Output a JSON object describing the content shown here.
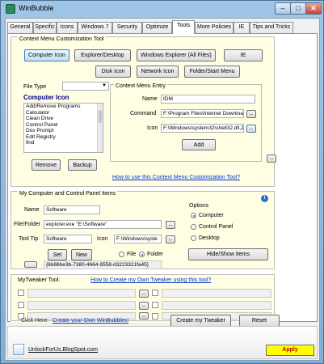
{
  "window": {
    "title": "WinBubble"
  },
  "tabs": [
    "General",
    "Specific",
    "Icons",
    "Windows 7",
    "Security",
    "Optimize",
    "Tools",
    "More Policies",
    "IE",
    "Tips and Tricks"
  ],
  "context_menu": {
    "title": "Context Menu Customization Tool",
    "row1": [
      "Computer Icon",
      "Explorer/Desktop",
      "Windows Explorer (All Files)",
      "IE"
    ],
    "row2": [
      "Disk Icon",
      "Network Icon",
      "Folder/Start Menu"
    ],
    "file_type_label": "File Type",
    "file_type_value": "",
    "heading": "Computer Icon",
    "items": [
      "Add/Remove Programs",
      "Calculator",
      "Clean Drive",
      "Control Panel",
      "Dos Prompt",
      "Edit Registry",
      "find"
    ],
    "remove_label": "Remove",
    "backup_label": "Backup",
    "help_link": "How to use this Context Menu Customization Tool?",
    "entry": {
      "title": "Context Menu Entry",
      "name_label": "Name",
      "name_value": "IDM",
      "command_label": "Command",
      "command_value": "F:\\Program Files\\Internet Download M",
      "icon_label": "Icon",
      "icon_value": "F:\\Windows\\system32\\shell32.dll,245",
      "browse": "...",
      "add_label": "Add"
    },
    "extra_browse": "..."
  },
  "panel_items": {
    "title": "My Computer and Control Panel Items",
    "name_label": "Name",
    "name_value": "Software",
    "file_label": "File/Folder",
    "file_value": "explorer.exe \"E:\\Software\"",
    "tooltip_label": "Tool Tip",
    "tooltip_value": "Software",
    "icon_label": "Icon",
    "icon_value": "F:\\Windows\\syste",
    "browse": "...",
    "set_label": "Set",
    "new_label": "New",
    "file_radio": "File",
    "folder_radio": "Folder",
    "small_btn": "",
    "guid": "{6b86be3b-7380-4664-9558-d3223321fa45}",
    "info": "i",
    "options_title": "Options",
    "options": [
      "Computer",
      "Control Panel",
      "Desktop"
    ],
    "selected_option": 0,
    "hide_show_label": "Hide/Show Items"
  },
  "tweaker": {
    "title": "MyTweaker Tool:",
    "howto_link": "How to Create my Own Tweaker using this tool?",
    "browse": "...",
    "click_here": "Click Here:",
    "create_link": "Create your Own WinBubbles!",
    "create_btn": "Create my Tweaker",
    "reset_btn": "Reset"
  },
  "footer": {
    "site_link": "UnlockForUs.BlogSpot.com",
    "apply": "Apply"
  }
}
